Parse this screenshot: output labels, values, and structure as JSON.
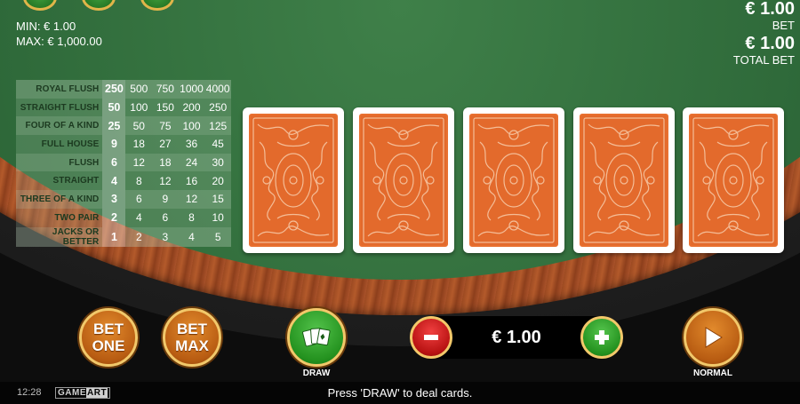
{
  "limits": {
    "min": "MIN: € 1.00",
    "max": "MAX: € 1,000.00"
  },
  "bet_info": {
    "bet_value": "€ 1.00",
    "bet_label": "BET",
    "total_value": "€ 1.00",
    "total_label": "TOTAL BET"
  },
  "paytable": [
    {
      "hand": "ROYAL FLUSH",
      "p1": "250",
      "p2": "500",
      "p3": "750",
      "p4": "1000",
      "p5": "4000"
    },
    {
      "hand": "STRAIGHT FLUSH",
      "p1": "50",
      "p2": "100",
      "p3": "150",
      "p4": "200",
      "p5": "250"
    },
    {
      "hand": "FOUR OF A KIND",
      "p1": "25",
      "p2": "50",
      "p3": "75",
      "p4": "100",
      "p5": "125"
    },
    {
      "hand": "FULL HOUSE",
      "p1": "9",
      "p2": "18",
      "p3": "27",
      "p4": "36",
      "p5": "45"
    },
    {
      "hand": "FLUSH",
      "p1": "6",
      "p2": "12",
      "p3": "18",
      "p4": "24",
      "p5": "30"
    },
    {
      "hand": "STRAIGHT",
      "p1": "4",
      "p2": "8",
      "p3": "12",
      "p4": "16",
      "p5": "20"
    },
    {
      "hand": "THREE OF A KIND",
      "p1": "3",
      "p2": "6",
      "p3": "9",
      "p4": "12",
      "p5": "15"
    },
    {
      "hand": "TWO PAIR",
      "p1": "2",
      "p2": "4",
      "p3": "6",
      "p4": "8",
      "p5": "10"
    },
    {
      "hand": "JACKS OR BETTER",
      "p1": "1",
      "p2": "2",
      "p3": "3",
      "p4": "4",
      "p5": "5"
    }
  ],
  "cards": {
    "count": 5,
    "state": "face-down",
    "back_color": "#e36a2c"
  },
  "controls": {
    "bet_one": {
      "line1": "BET",
      "line2": "ONE"
    },
    "bet_max": {
      "line1": "BET",
      "line2": "MAX"
    },
    "draw_label": "DRAW",
    "bet_amount": "€ 1.00",
    "normal_label": "NORMAL",
    "icons": {
      "draw": "cards-icon",
      "minus": "minus-icon",
      "plus": "plus-icon",
      "normal": "play-icon"
    }
  },
  "status": {
    "clock": "12:28",
    "logo_a": "GAME",
    "logo_b": "ART",
    "message": "Press 'DRAW' to deal cards."
  },
  "colors": {
    "felt": "#2f6a3a",
    "wood": "#a9522a",
    "gold": "#f2c86a",
    "bet_orange": "#b85c12",
    "draw_green": "#24921f",
    "minus_red": "#b81212"
  }
}
